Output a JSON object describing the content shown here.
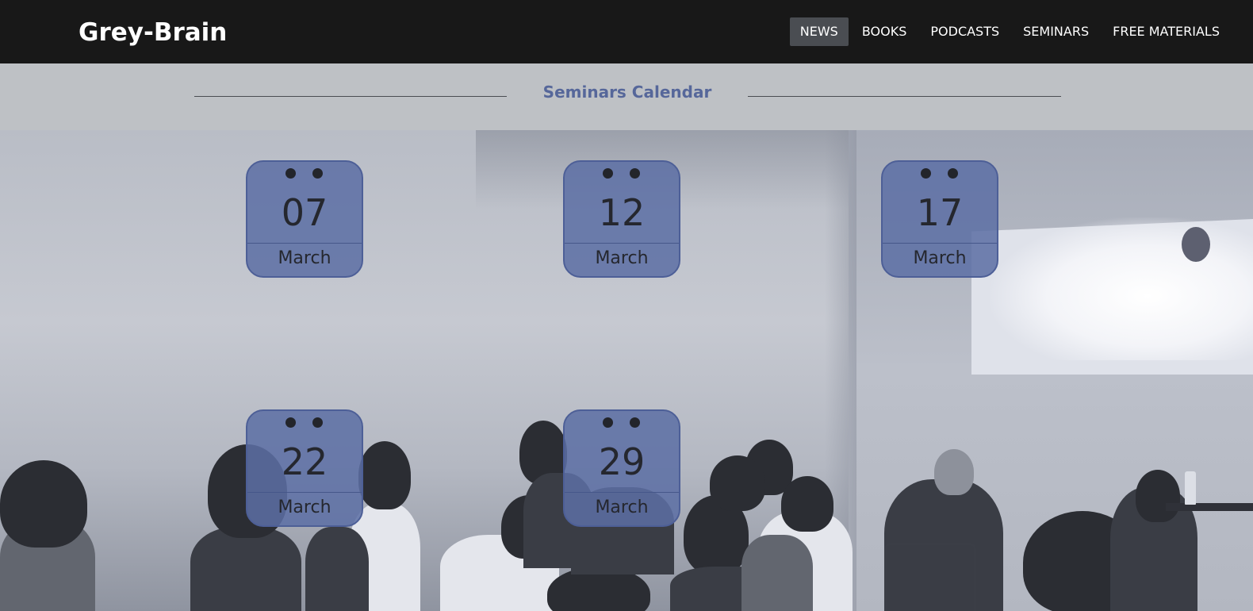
{
  "navbar": {
    "brand": "Grey-Brain",
    "items": [
      {
        "label": "NEWS",
        "active": true
      },
      {
        "label": "BOOKS",
        "active": false
      },
      {
        "label": "PODCASTS",
        "active": false
      },
      {
        "label": "SEMINARS",
        "active": false
      },
      {
        "label": "FREE MATERIALS",
        "active": false
      }
    ]
  },
  "header": {
    "title": "Seminars Calendar"
  },
  "calendar": {
    "dates": [
      {
        "day": "07",
        "month": "March"
      },
      {
        "day": "12",
        "month": "March"
      },
      {
        "day": "17",
        "month": "March"
      },
      {
        "day": "22",
        "month": "March"
      },
      {
        "day": "29",
        "month": "March"
      }
    ]
  },
  "colors": {
    "navbar_bg": "#181818",
    "active_nav_bg": "#4a4d52",
    "header_band_bg": "#bec1c5",
    "header_title": "#56679a",
    "card_fill": "#5c6fa4",
    "card_border": "#4d5f97"
  }
}
